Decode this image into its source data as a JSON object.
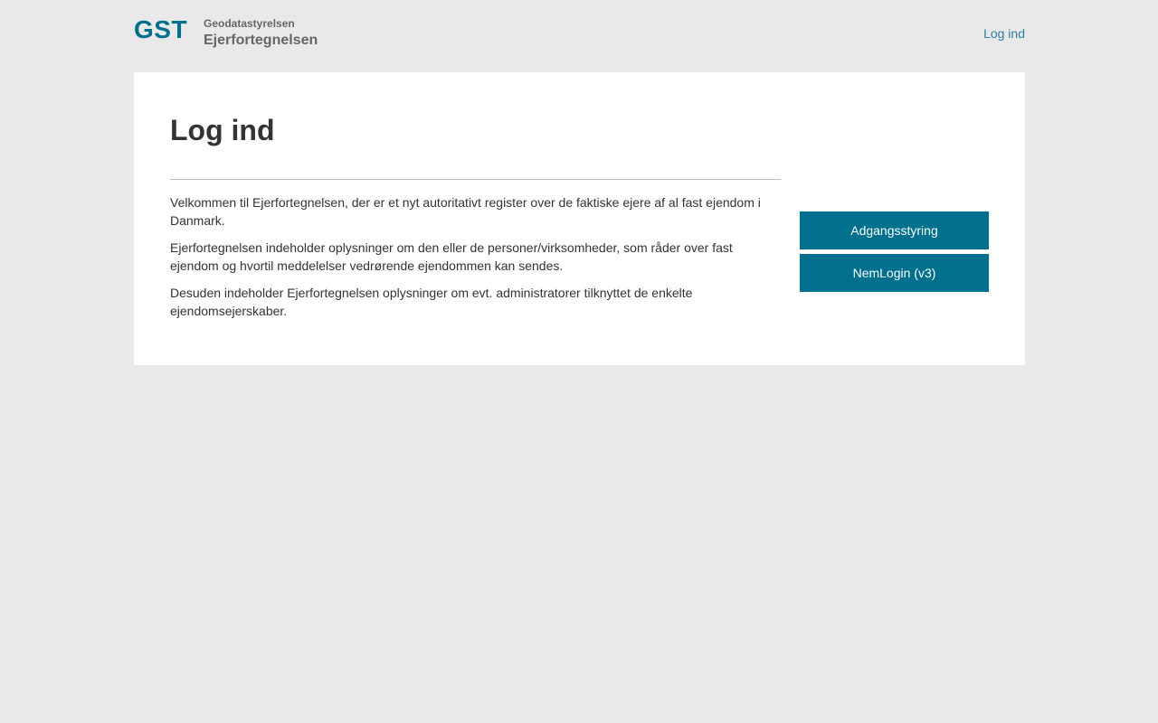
{
  "header": {
    "logo_text": "GST",
    "organization": "Geodatastyrelsen",
    "app_name": "Ejerfortegnelsen",
    "login_link": "Log ind"
  },
  "main": {
    "title": "Log ind",
    "paragraphs": [
      "Velkommen til Ejerfortegnelsen, der er et nyt autoritativt register over de faktiske ejere af al fast ejendom i Danmark.",
      "Ejerfortegnelsen indeholder oplysninger om den eller de personer/virksomheder, som råder over fast ejendom og hvortil meddelelser vedrørende ejendommen kan sendes.",
      "Desuden indeholder Ejerfortegnelsen oplysninger om evt. administratorer tilknyttet de enkelte ejendomsejerskaber."
    ],
    "buttons": {
      "access_control": "Adgangsstyring",
      "nemlogin": "NemLogin (v3)"
    }
  },
  "colors": {
    "brand": "#00708f",
    "background": "#e9e9e9",
    "card": "#ffffff",
    "link": "#2a7fa0"
  }
}
